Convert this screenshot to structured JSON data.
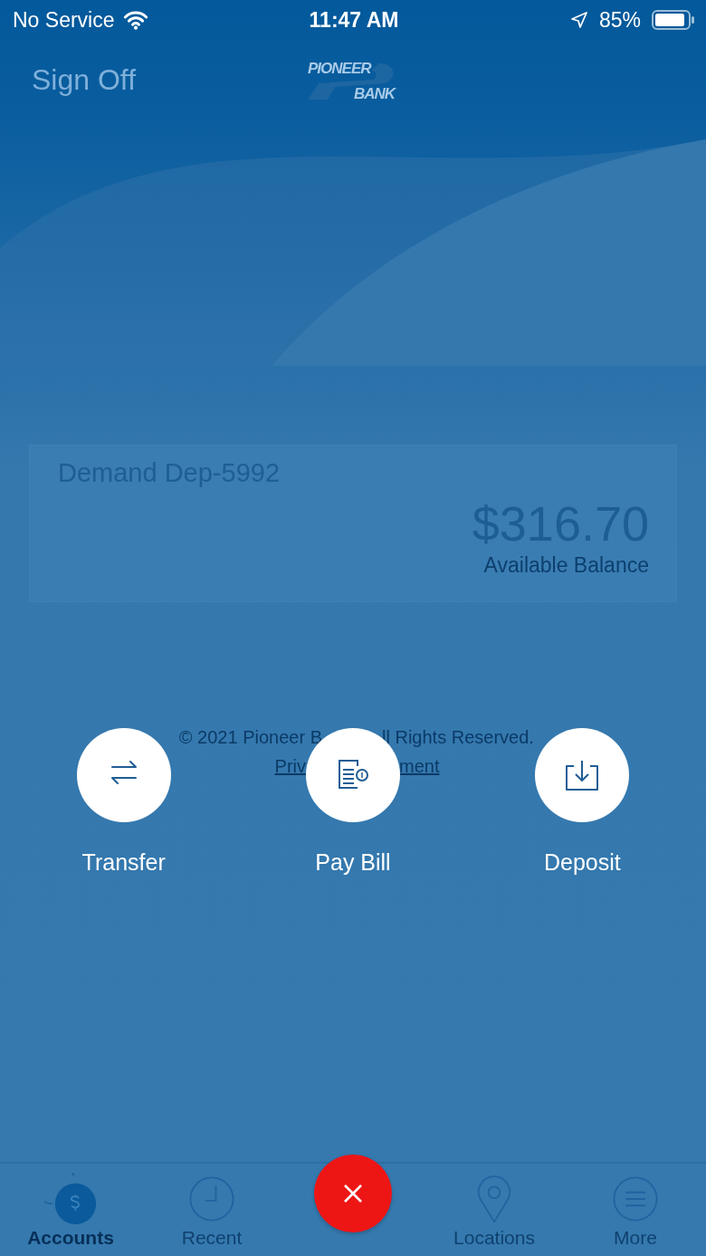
{
  "status_bar": {
    "carrier": "No Service",
    "time": "11:47 AM",
    "battery": "85%"
  },
  "header": {
    "sign_off": "Sign Off",
    "logo": {
      "line1": "PIONEER",
      "line2": "BANK"
    }
  },
  "account": {
    "name": "Demand Dep-5992",
    "balance": "$316.70",
    "balance_label": "Available Balance"
  },
  "footer": {
    "copyright_parts": [
      "© 2021 Pioneer B",
      "ll Rights Reserved."
    ],
    "privacy_parts": [
      "Priv",
      "ment"
    ]
  },
  "actions": [
    {
      "kind": "transfer",
      "label": "Transfer"
    },
    {
      "kind": "bill",
      "label": "Pay Bill"
    },
    {
      "kind": "deposit",
      "label": "Deposit"
    }
  ],
  "tab_bar": [
    {
      "kind": "accounts",
      "label": "Accounts",
      "selected": true
    },
    {
      "kind": "recent",
      "label": "Recent",
      "selected": false
    },
    {
      "kind": "close"
    },
    {
      "kind": "locations",
      "label": "Locations",
      "selected": false
    },
    {
      "kind": "more",
      "label": "More",
      "selected": false
    }
  ]
}
